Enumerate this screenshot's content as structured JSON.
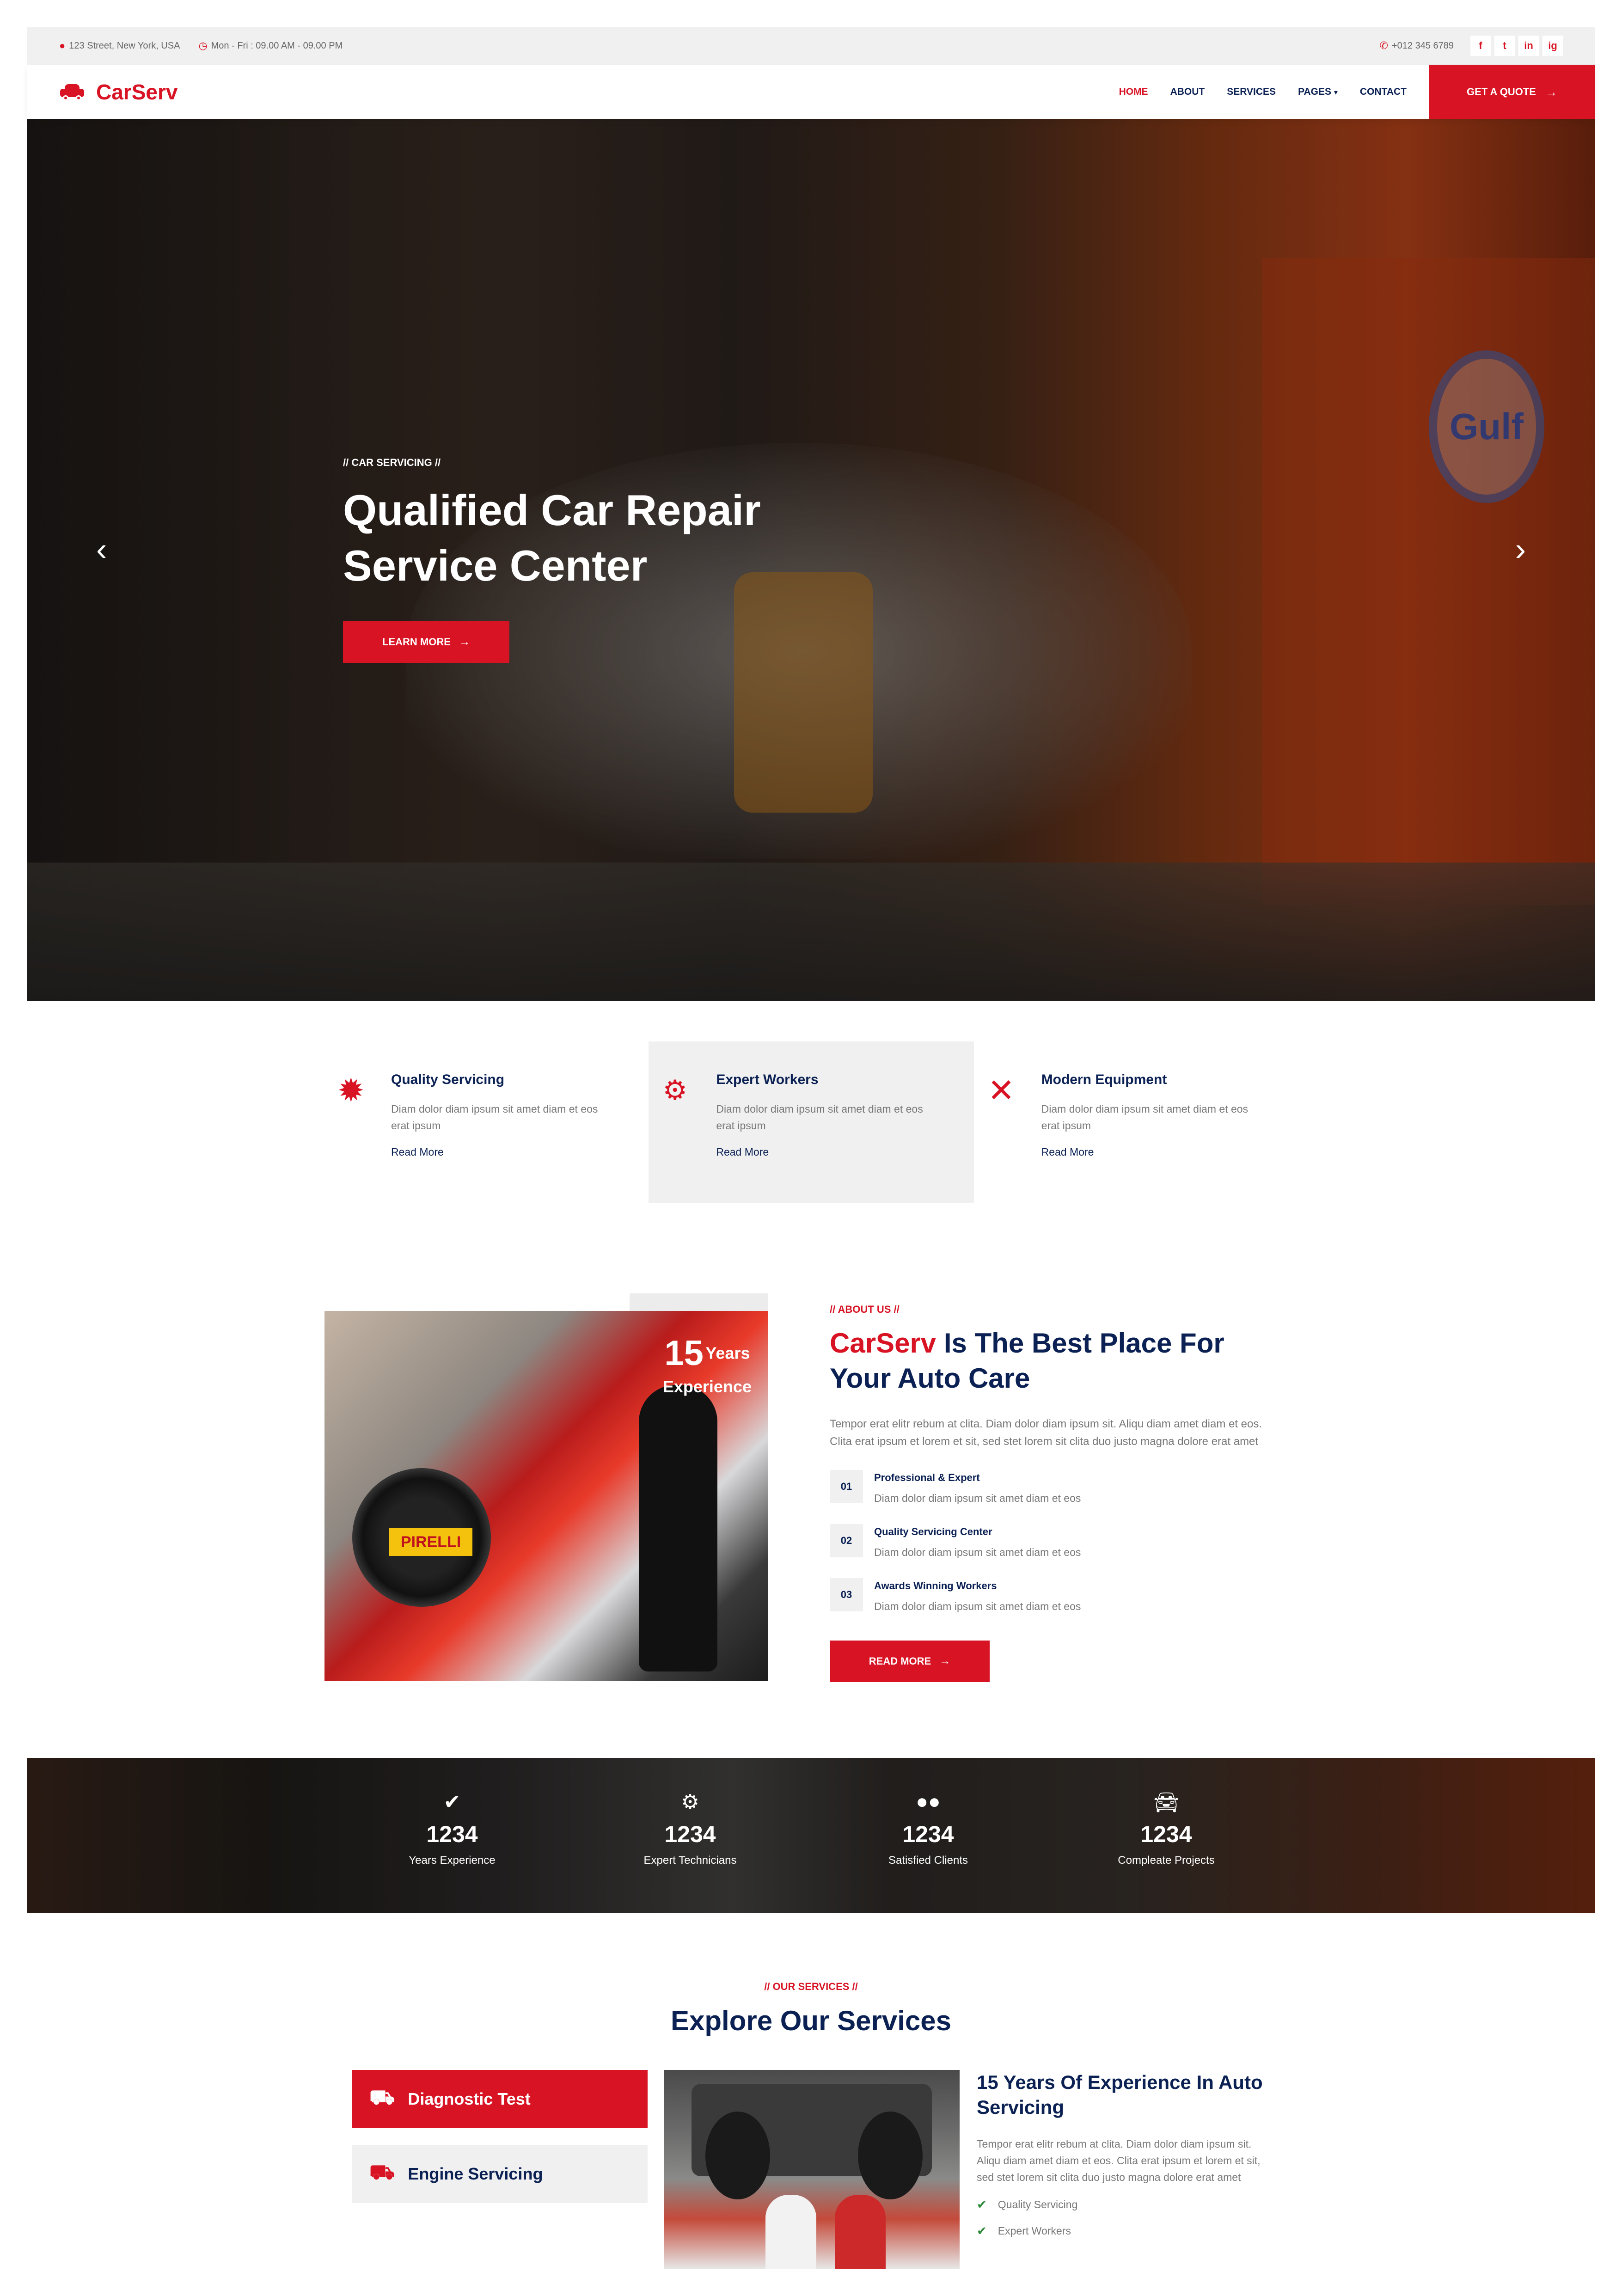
{
  "topbar": {
    "address": "123 Street, New York, USA",
    "hours": "Mon - Fri : 09.00 AM - 09.00 PM",
    "phone": "+012 345 6789",
    "social": [
      "f",
      "t",
      "in",
      "ig"
    ]
  },
  "navbar": {
    "brand": "CarServ",
    "items": [
      "HOME",
      "ABOUT",
      "SERVICES",
      "PAGES",
      "CONTACT"
    ],
    "quote": "GET A QUOTE"
  },
  "hero": {
    "kicker": "// CAR SERVICING //",
    "title": "Qualified Car Repair Service Center",
    "button": "LEARN MORE",
    "gulf": "Gulf"
  },
  "features": [
    {
      "title": "Quality Servicing",
      "text": "Diam dolor diam ipsum sit amet diam et eos erat ipsum",
      "link": "Read More"
    },
    {
      "title": "Expert Workers",
      "text": "Diam dolor diam ipsum sit amet diam et eos erat ipsum",
      "link": "Read More"
    },
    {
      "title": "Modern Equipment",
      "text": "Diam dolor diam ipsum sit amet diam et eos erat ipsum",
      "link": "Read More"
    }
  ],
  "about": {
    "badge_num": "15",
    "badge_years": "Years",
    "badge_exp": "Experience",
    "pirelli": "PIRELLI",
    "kicker": "// ABOUT US //",
    "title_red": "CarServ",
    "title_rest": " Is The Best Place For Your Auto Care",
    "desc": "Tempor erat elitr rebum at clita. Diam dolor diam ipsum sit. Aliqu diam amet diam et eos. Clita erat ipsum et lorem et sit, sed stet lorem sit clita duo justo magna dolore erat amet",
    "points": [
      {
        "num": "01",
        "title": "Professional & Expert",
        "text": "Diam dolor diam ipsum sit amet diam et eos"
      },
      {
        "num": "02",
        "title": "Quality Servicing Center",
        "text": "Diam dolor diam ipsum sit amet diam et eos"
      },
      {
        "num": "03",
        "title": "Awards Winning Workers",
        "text": "Diam dolor diam ipsum sit amet diam et eos"
      }
    ],
    "button": "READ MORE"
  },
  "stats": [
    {
      "num": "1234",
      "label": "Years Experience"
    },
    {
      "num": "1234",
      "label": "Expert Technicians"
    },
    {
      "num": "1234",
      "label": "Satisfied Clients"
    },
    {
      "num": "1234",
      "label": "Compleate Projects"
    }
  ],
  "services": {
    "kicker": "// OUR SERVICES //",
    "title": "Explore Our Services",
    "tabs": [
      "Diagnostic Test",
      "Engine Servicing"
    ],
    "detail_title": "15 Years Of Experience In Auto Servicing",
    "detail_text": "Tempor erat elitr rebum at clita. Diam dolor diam ipsum sit. Aliqu diam amet diam et eos. Clita erat ipsum et lorem et sit, sed stet lorem sit clita duo justo magna dolore erat amet",
    "checks": [
      "Quality Servicing",
      "Expert Workers"
    ]
  },
  "colors": {
    "accent": "#d81324",
    "dark": "#0b2154",
    "light": "#f0f0f0"
  }
}
